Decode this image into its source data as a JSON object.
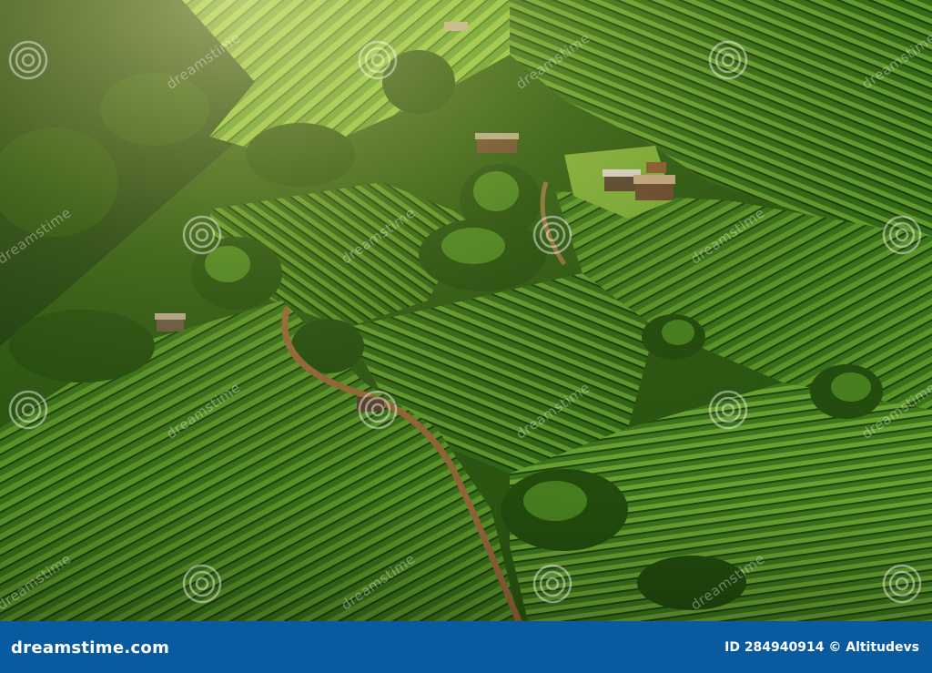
{
  "photo": {
    "subject": "aerial-terraced-plantation",
    "watermark_text": "dreamstime",
    "watermark_icon": "dreamstime-spiral-icon"
  },
  "footer": {
    "site": "dreamstime.com",
    "id_label": "ID 284940914",
    "copyright_symbol": "©",
    "author": "Altitudevs"
  },
  "colors": {
    "footer_bg": "#0a5aa0",
    "foliage_dark": "#1f4a0c",
    "foliage_mid": "#3f7a1c",
    "foliage_light": "#8bbf3a",
    "path_soil": "#9a6a3a"
  }
}
